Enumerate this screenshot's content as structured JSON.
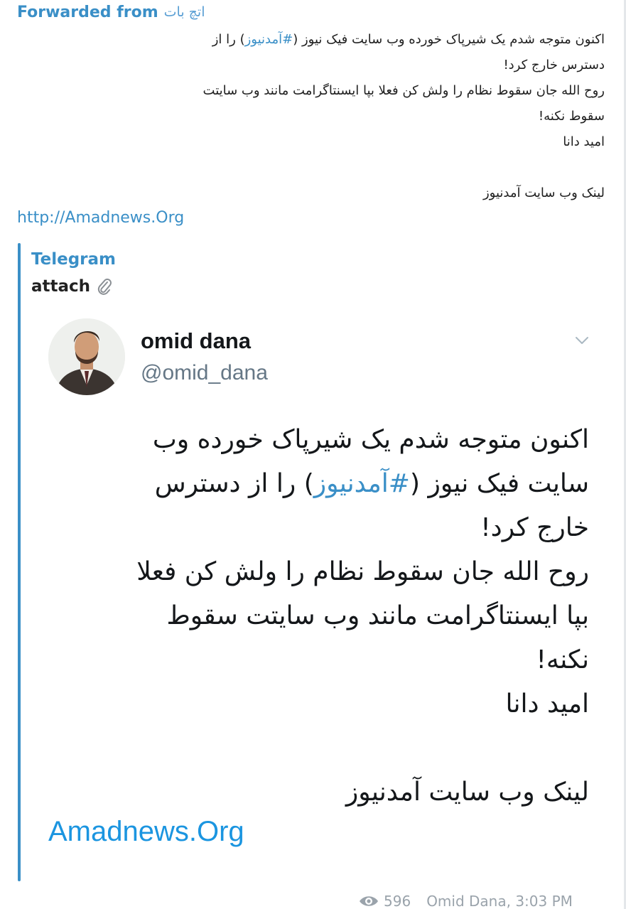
{
  "forward": {
    "label": "Forwarded from",
    "source": "اتچ بات"
  },
  "message": {
    "line1_a": "اکنون متوجه شدم یک شیرپاک خورده وب سایت فیک نیوز (",
    "line1_hashtag": "#آمدنیوز",
    "line1_b": ") را از",
    "line2": "دسترس خارج کرد!",
    "line3": "روح الله جان سقوط نظام را ولش کن فعلا بپا ایسنتاگرامت مانند وب سایتت",
    "line4": "سقوط نکنه!",
    "line5": "امید دانا",
    "line6": "لینک وب سایت آمدنیوز",
    "link": "http://Amadnews.Org"
  },
  "preview": {
    "site_name": "Telegram",
    "title": "attach"
  },
  "tweet": {
    "author_name": "omid dana",
    "handle": "@omid_dana",
    "line1": "اکنون متوجه شدم یک شیرپاک خورده وب",
    "line2_a": "سایت فیک نیوز (",
    "line2_hashtag": "#آمدنیوز",
    "line2_b": ") را از دسترس",
    "line3": "خارج کرد!",
    "line4": "روح الله جان سقوط نظام را ولش کن فعلا",
    "line5": "بپا ایسنتاگرامت مانند وب سایتت سقوط",
    "line6": "نکنه!",
    "line7": "امید دانا",
    "line8": "لینک وب سایت آمدنیوز",
    "link": "Amadnews.Org"
  },
  "meta": {
    "views": "596",
    "author": "Omid Dana, 3:03 PM"
  },
  "icons": {
    "attach": "paperclip-icon",
    "chevron": "chevron-down-icon",
    "views": "eye-icon"
  },
  "colors": {
    "link_blue": "#3a8fc7",
    "twitter_blue": "#1b95e0",
    "meta_gray": "#9aa3ab"
  }
}
